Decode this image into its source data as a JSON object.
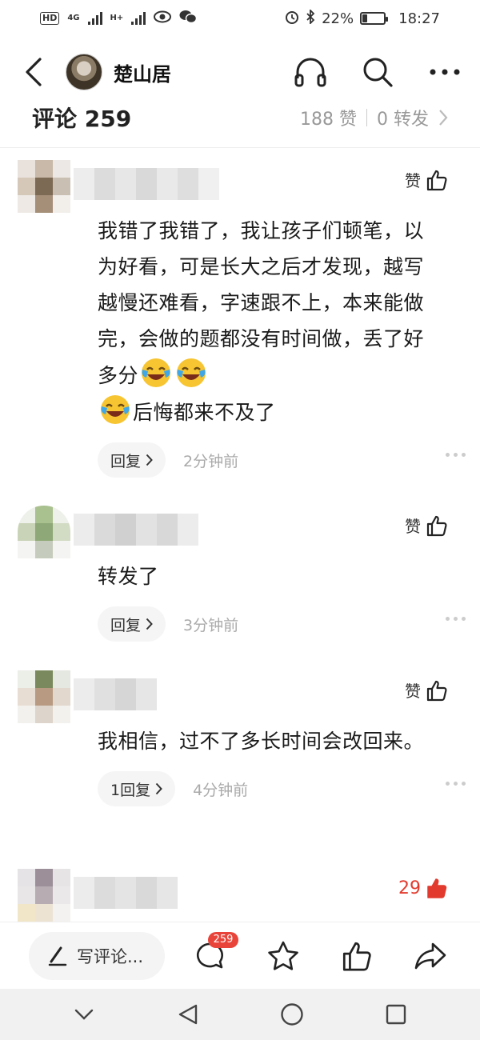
{
  "status_bar": {
    "hd": "HD",
    "net_1": "4G",
    "net_2": "H+",
    "battery": "22%",
    "battery_level": 0.22,
    "time": "18:27"
  },
  "nav": {
    "title": "楚山居"
  },
  "header": {
    "title": "评论 259",
    "likes": "188 赞",
    "shares": "0 转发"
  },
  "comments": [
    {
      "like_label": "赞",
      "text_parts": [
        "我错了我错了，我让孩子们顿笔，以为好看，可是长大之后才发现，越写越慢还难看，字速跟不上，本来能做完，会做的题都没有时间做，丢了好多分",
        "后悔都来不及了"
      ],
      "reply_label": "回复",
      "time": "2分钟前"
    },
    {
      "like_label": "赞",
      "text": "转发了",
      "reply_label": "回复",
      "time": "3分钟前"
    },
    {
      "like_label": "赞",
      "text": "我相信，过不了多长时间会改回来。",
      "reply_label": "1回复",
      "time": "4分钟前"
    },
    {
      "like_count": "29"
    }
  ],
  "bottom_bar": {
    "write_label": "写评论...",
    "comment_badge": "259"
  },
  "colors": {
    "accent_red": "#e23b2e",
    "muted": "#999999"
  }
}
